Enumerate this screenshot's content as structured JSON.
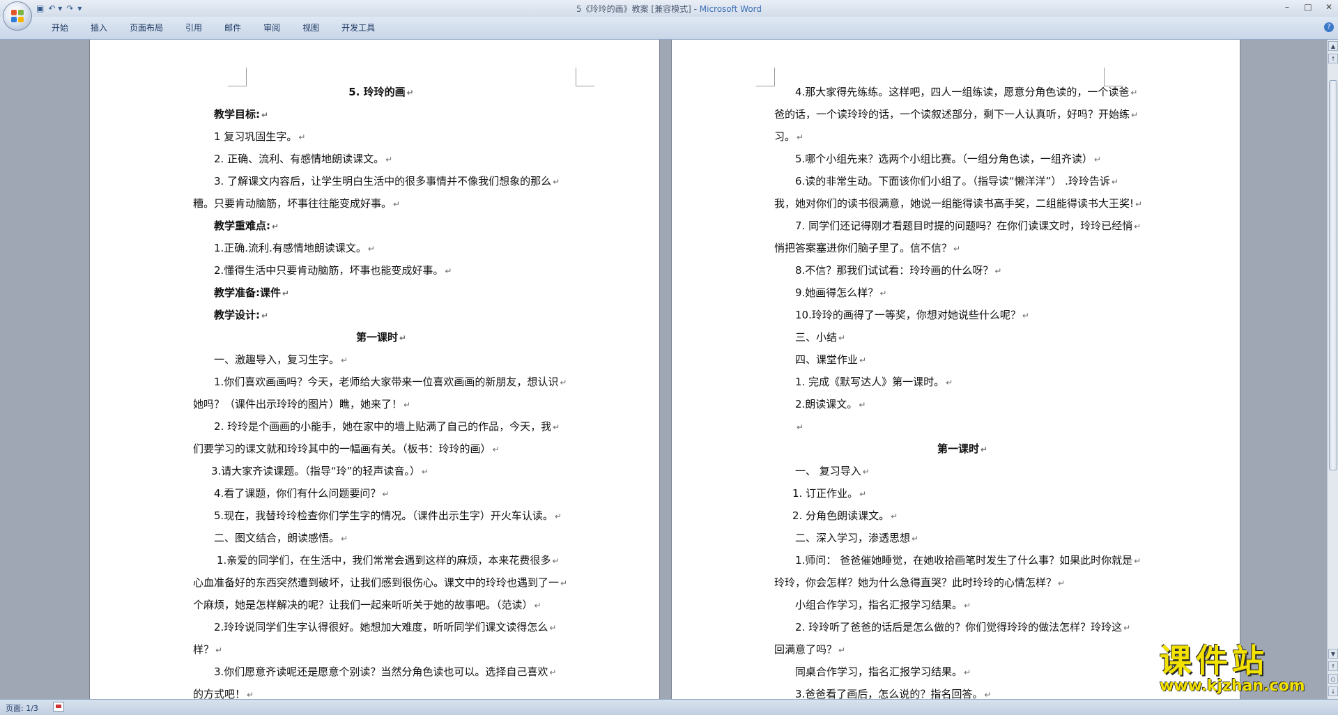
{
  "window": {
    "title": "5《玲玲的画》教案 [兼容模式] - ",
    "app_name": "Microsoft Word"
  },
  "quick_access": {
    "save": "▣",
    "undo": "↶ ▾",
    "redo": "↷",
    "customize": "▾"
  },
  "window_controls": {
    "minimize": "–",
    "restore": "□",
    "close": "✕"
  },
  "ribbon_tabs": [
    "开始",
    "插入",
    "页面布局",
    "引用",
    "邮件",
    "审阅",
    "视图",
    "开发工具"
  ],
  "help_glyph": "?",
  "status": {
    "page_info": "页面: 1/3"
  },
  "paragraph_mark": "↵",
  "left_page": [
    {
      "t": "5. 玲玲的画",
      "s": "center bold"
    },
    {
      "t": "教学目标:",
      "s": "bold",
      "i": 30
    },
    {
      "t": "1   复习巩固生字。",
      "s": "",
      "i": 30
    },
    {
      "t": "2. 正确、流利、有感情地朗读课文。",
      "s": "",
      "i": 30
    },
    {
      "t": "3. 了解课文内容后，让学生明白生活中的很多事情并不像我们想象的那么",
      "s": "",
      "i": 30
    },
    {
      "t": "糟。只要肯动脑筋，坏事往往能变成好事。",
      "s": "",
      "i": 0
    },
    {
      "t": "教学重难点:",
      "s": "bold",
      "i": 30
    },
    {
      "t": "1.正确.流利.有感情地朗读课文。",
      "s": "",
      "i": 30
    },
    {
      "t": "2.懂得生活中只要肯动脑筋，坏事也能变成好事。",
      "s": "",
      "i": 30
    },
    {
      "t": "教学准备:课件",
      "s": "bold",
      "i": 30
    },
    {
      "t": "教学设计:",
      "s": "bold",
      "i": 30
    },
    {
      "t": "第一课时",
      "s": "center bold"
    },
    {
      "t": "一、激趣导入，复习生字。",
      "s": "",
      "i": 30
    },
    {
      "t": "1.你们喜欢画画吗？今天，老师给大家带来一位喜欢画画的新朋友，想认识",
      "s": "",
      "i": 30
    },
    {
      "t": "她吗？（课件出示玲玲的图片）瞧，她来了！",
      "s": "",
      "i": 0
    },
    {
      "t": "2. 玲玲是个画画的小能手，她在家中的墙上贴满了自己的作品，今天，我",
      "s": "",
      "i": 30
    },
    {
      "t": "们要学习的课文就和玲玲其中的一幅画有关。（板书：玲玲的画）",
      "s": "",
      "i": 0
    },
    {
      "t": "3.请大家齐读课题。（指导“玲”的轻声读音。）",
      "s": "",
      "i": 26
    },
    {
      "t": "4.看了课题，你们有什么问题要问？",
      "s": "",
      "i": 30
    },
    {
      "t": "5.现在，我替玲玲检查你们学生字的情况。（课件出示生字）开火车认读。",
      "s": "",
      "i": 30
    },
    {
      "t": "二、图文结合，朗读感悟。",
      "s": "",
      "i": 30
    },
    {
      "t": "1.亲爱的同学们，在生活中，我们常常会遇到这样的麻烦，本来花费很多",
      "s": "",
      "i": 34
    },
    {
      "t": "心血准备好的东西突然遭到破坏，让我们感到很伤心。课文中的玲玲也遇到了一",
      "s": "",
      "i": 0
    },
    {
      "t": "个麻烦，她是怎样解决的呢？让我们一起来听听关于她的故事吧。（范读）",
      "s": "",
      "i": 0
    },
    {
      "t": "2.玲玲说同学们生字认得很好。她想加大难度，听听同学们课文读得怎么",
      "s": "",
      "i": 30
    },
    {
      "t": "样？",
      "s": "",
      "i": 0
    },
    {
      "t": "3.你们愿意齐读呢还是愿意个别读？当然分角色读也可以。选择自己喜欢",
      "s": "",
      "i": 30
    },
    {
      "t": "的方式吧！",
      "s": "",
      "i": 0
    }
  ],
  "right_page": [
    {
      "t": "4.那大家得先练练。这样吧，四人一组练读，愿意分角色读的，一个读爸",
      "s": "",
      "i": 30
    },
    {
      "t": "爸的话，一个读玲玲的话，一个读叙述部分，剩下一人认真听，好吗？开始练",
      "s": "",
      "i": 0
    },
    {
      "t": "习。",
      "s": "",
      "i": 0
    },
    {
      "t": "5.哪个小组先来？选两个小组比赛。（一组分角色读，一组齐读）",
      "s": "",
      "i": 30
    },
    {
      "t": "6.读的非常生动。下面该你们小组了。（指导读“懒洋洋”） .玲玲告诉",
      "s": "",
      "i": 30
    },
    {
      "t": "我，她对你们的读书很满意，她说一组能得读书高手奖，二组能得读书大王奖!",
      "s": "",
      "i": 0
    },
    {
      "t": "7. 同学们还记得刚才看题目时提的问题吗？在你们读课文时，玲玲已经悄",
      "s": "",
      "i": 30
    },
    {
      "t": "悄把答案塞进你们脑子里了。信不信？",
      "s": "",
      "i": 0
    },
    {
      "t": "8.不信？那我们试试看：玲玲画的什么呀？",
      "s": "",
      "i": 30
    },
    {
      "t": "9.她画得怎么样？",
      "s": "",
      "i": 30
    },
    {
      "t": "10.玲玲的画得了一等奖，你想对她说些什么呢？",
      "s": "",
      "i": 30
    },
    {
      "t": "三、小结",
      "s": "",
      "i": 30
    },
    {
      "t": "四、课堂作业",
      "s": "",
      "i": 30
    },
    {
      "t": "1. 完成《默写达人》第一课时。",
      "s": "",
      "i": 30
    },
    {
      "t": "2.朗读课文。",
      "s": "",
      "i": 30
    },
    {
      "t": "",
      "s": "",
      "i": 30
    },
    {
      "t": "第一课时",
      "s": "center bold"
    },
    {
      "t": "一、     复习导入",
      "s": "",
      "i": 30
    },
    {
      "t": "1. 订正作业。",
      "s": "",
      "i": 26
    },
    {
      "t": "2. 分角色朗读课文。",
      "s": "",
      "i": 26
    },
    {
      "t": "二、深入学习，渗透思想",
      "s": "",
      "i": 30
    },
    {
      "t": "1.师问：  爸爸催她睡觉，在她收拾画笔时发生了什么事？如果此时你就是",
      "s": "",
      "i": 30
    },
    {
      "t": "玲玲，你会怎样？她为什么急得直哭？此时玲玲的心情怎样？",
      "s": "",
      "i": 0
    },
    {
      "t": "小组合作学习，指名汇报学习结果。",
      "s": "",
      "i": 30
    },
    {
      "t": "2. 玲玲听了爸爸的话后是怎么做的？你们觉得玲玲的做法怎样？玲玲这",
      "s": "",
      "i": 30
    },
    {
      "t": "回满意了吗？",
      "s": "",
      "i": 0
    },
    {
      "t": "同桌合作学习，指名汇报学习结果。",
      "s": "",
      "i": 30
    },
    {
      "t": "3.爸爸看了画后，怎么说的？指名回答。",
      "s": "",
      "i": 30
    }
  ],
  "watermark": {
    "name": "课件站",
    "url": "www.kjzhan.com"
  },
  "scrollbar": {
    "up": "▲",
    "down": "▼",
    "prev": "↑",
    "browse": "○",
    "next": "↓"
  }
}
